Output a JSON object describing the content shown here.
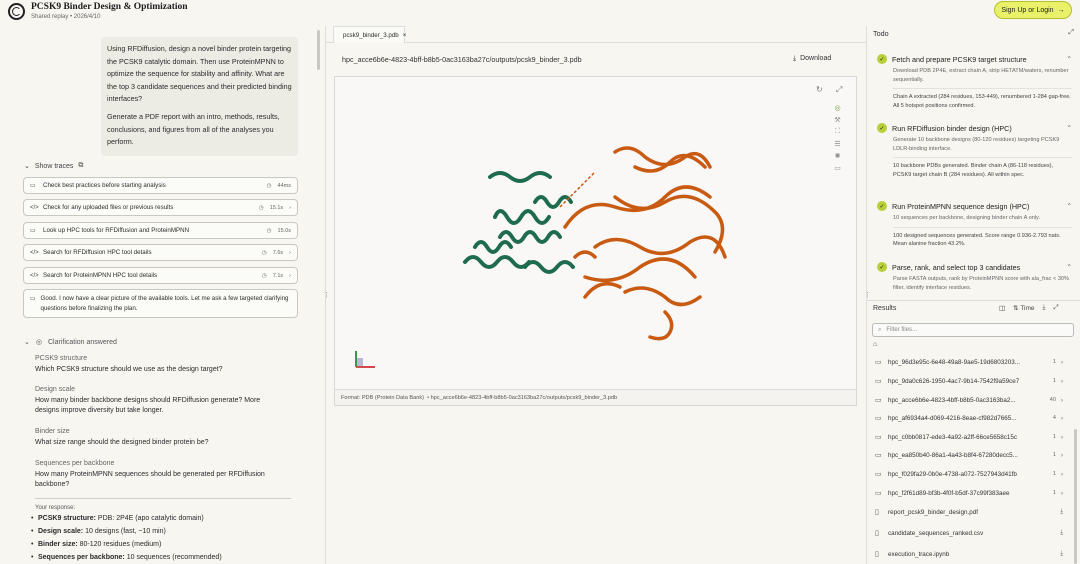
{
  "header": {
    "title": "PCSK9 Binder Design & Optimization",
    "subtitle": "Shared replay • 2026/4/10",
    "signup": "Sign Up or Login",
    "signup_arrow": "→"
  },
  "prompt": {
    "p1": "Using RFDiffusion, design a novel binder protein targeting the PCSK9 catalytic domain. Then use ProteinMPNN to optimize the sequence for stability and affinity. What are the top 3 candidate sequences and their predicted binding interfaces?",
    "p2": "Generate a PDF report with an intro, methods, results, conclusions, and figures from all of the analyses you perform."
  },
  "traces": {
    "label": "Show traces",
    "items": [
      {
        "text": "Check best practices before starting analysis",
        "time": "44ms"
      },
      {
        "text": "Check for any uploaded files or previous results",
        "time": "15.1s"
      },
      {
        "text": "Look up HPC tools for RFDiffusion and ProteinMPNN",
        "time": "15.0s"
      },
      {
        "text": "Search for RFDiffusion HPC tool details",
        "time": "7.6s"
      },
      {
        "text": "Search for ProteinMPNN HPC tool details",
        "time": "7.1s"
      }
    ],
    "message": "Good. I now have a clear picture of the available tools. Let me ask a few targeted clarifying questions before finalizing the plan."
  },
  "clarification": {
    "label": "Clarification answered",
    "questions": [
      {
        "h": "PCSK9 structure",
        "q": "Which PCSK9 structure should we use as the design target?"
      },
      {
        "h": "Design scale",
        "q": "How many binder backbone designs should RFDiffusion generate? More designs improve diversity but take longer."
      },
      {
        "h": "Binder size",
        "q": "What size range should the designed binder protein be?"
      },
      {
        "h": "Sequences per backbone",
        "q": "How many ProteinMPNN sequences should be generated per RFDiffusion backbone?"
      }
    ],
    "response_label": "Your response:",
    "responses": [
      {
        "k": "PCSK9 structure:",
        "v": "PDB: 2P4E (apo catalytic domain)"
      },
      {
        "k": "Design scale:",
        "v": "10 designs (fast, ~10 min)"
      },
      {
        "k": "Binder size:",
        "v": "80-120 residues (medium)"
      },
      {
        "k": "Sequences per backbone:",
        "v": "10 sequences (recommended)"
      }
    ]
  },
  "viewer": {
    "tab": "pcsk9_binder_3.pdb",
    "path": "hpc_acce6b6e-4823-4bff-b8b5-0ac3163ba27c/outputs/pcsk9_binder_3.pdb",
    "download": "Download",
    "format": "Format: PDB (Protein Data Bank)",
    "footer_path": "• hpc_acce6b6e-4823-4bff-b8b5-0ac3163ba27c/outputs/pcsk9_binder_3.pdb",
    "colors": {
      "binder": "#1e6b50",
      "target": "#c85a12"
    }
  },
  "todo": {
    "title": "Todo",
    "items": [
      {
        "t": "Fetch and prepare PCSK9 target structure",
        "d": "Download PDB 2P4E, extract chain A, strip HETATM/waters, renumber sequentially.",
        "r": "Chain A extracted (284 residues, 153-449), renumbered 1-284 gap-free. All 5 hotspot positions confirmed."
      },
      {
        "t": "Run RFDiffusion binder design (HPC)",
        "d": "Generate 10 backbone designs (80-120 residues) targeting PCSK9 LDLR-binding interface.",
        "r": "10 backbone PDBs generated. Binder chain A (86-118 residues), PCSK9 target chain B (284 residues). All within spec."
      },
      {
        "t": "Run ProteinMPNN sequence design (HPC)",
        "d": "10 sequences per backbone, designing binder chain A only.",
        "r": "100 designed sequences generated. Score range 0.936-2.793 nats. Mean alanine fraction 43.2%."
      },
      {
        "t": "Parse, rank, and select top 3 candidates",
        "d": "Parse FASTA outputs, rank by ProteinMPNN score with ala_frac < 30% filter, identify interface residues.",
        "r": ""
      }
    ]
  },
  "results": {
    "title": "Results",
    "time": "Time",
    "filter": "Filter files...",
    "folders": [
      {
        "n": "hpc_96d3e95c-6e48-49a8-9ae5-19d6803203...",
        "c": "1"
      },
      {
        "n": "hpc_9da0c626-1950-4ac7-9b14-7542f9a59ce7",
        "c": "1"
      },
      {
        "n": "hpc_acce6b6e-4823-4bff-b8b5-0ac3163ba2...",
        "c": "40"
      },
      {
        "n": "hpc_af6934a4-d069-4216-8eae-cf982d7665...",
        "c": "4"
      },
      {
        "n": "hpc_c0bb0817-ede3-4a92-a2ff-66ce5658c15c",
        "c": "1"
      },
      {
        "n": "hpc_ea850b40-86a1-4a43-b8f4-67280decc5...",
        "c": "1"
      },
      {
        "n": "hpc_f029fa29-0b0e-4738-a072-7527943d41fb",
        "c": "1"
      },
      {
        "n": "hpc_f2f61d89-bf3b-4f0f-b5df-37c99f383aee",
        "c": "1"
      }
    ],
    "files": [
      "report_pcsk9_binder_design.pdf",
      "candidate_sequences_ranked.csv",
      "execution_trace.ipynb"
    ]
  }
}
